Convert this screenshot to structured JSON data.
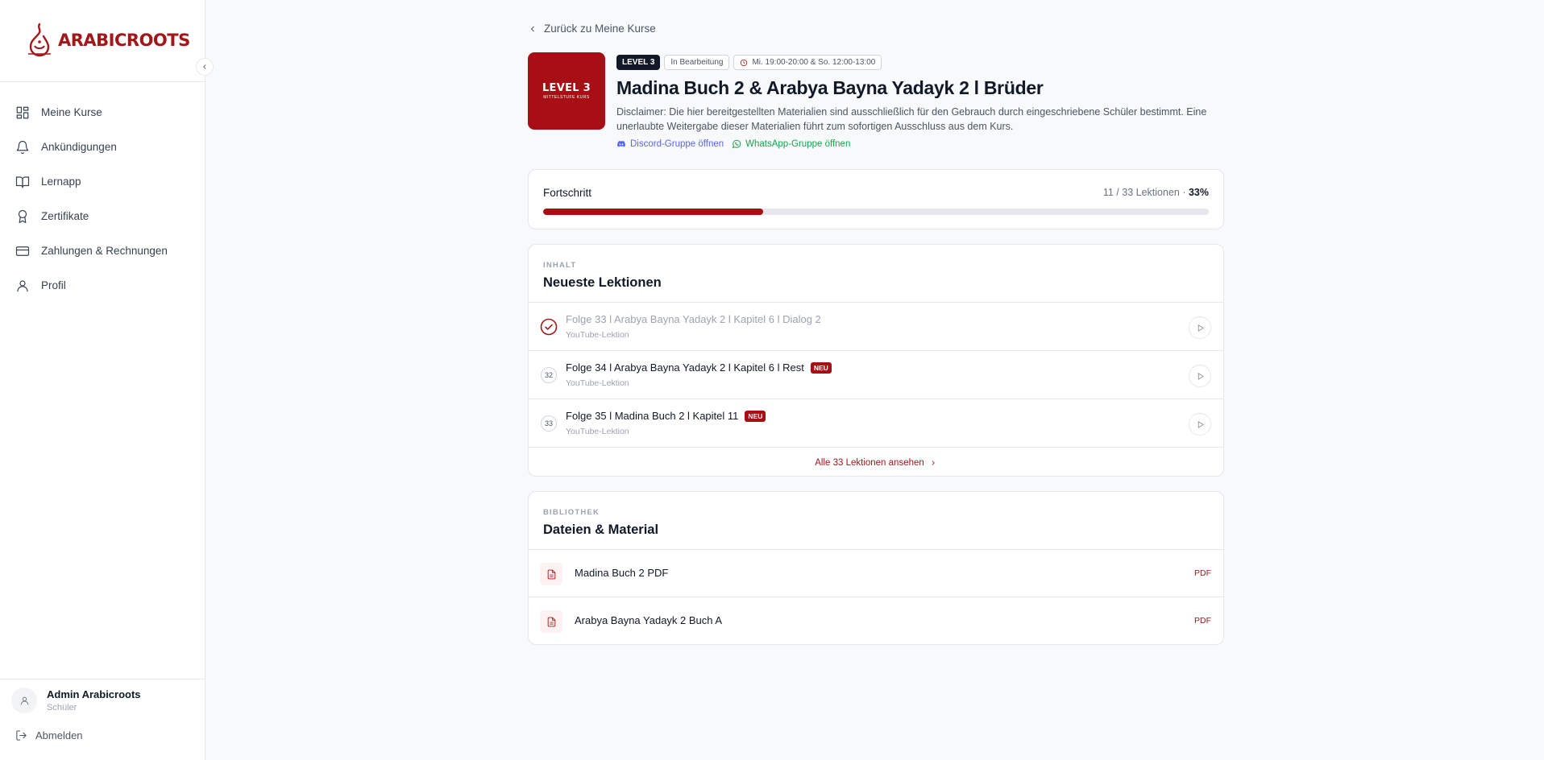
{
  "brand": {
    "name": "ARABICROOTS",
    "accent": "#a80f14"
  },
  "sidebar": {
    "items": [
      {
        "label": "Meine Kurse",
        "icon": "dashboard-icon"
      },
      {
        "label": "Ankündigungen",
        "icon": "bell-icon"
      },
      {
        "label": "Lernapp",
        "icon": "book-icon"
      },
      {
        "label": "Zertifikate",
        "icon": "award-icon"
      },
      {
        "label": "Zahlungen & Rechnungen",
        "icon": "credit-card-icon"
      },
      {
        "label": "Profil",
        "icon": "user-icon"
      }
    ],
    "user": {
      "name": "Admin Arabicroots",
      "role": "Schüler"
    },
    "logout": "Abmelden"
  },
  "course": {
    "back_label": "Zurück zu Meine Kurse",
    "thumb_title": "LEVEL 3",
    "thumb_subtitle": "MITTELSTUFE KURS",
    "level_badge": "LEVEL 3",
    "status_badge": "In Bearbeitung",
    "schedule": "Mi. 19:00-20:00 & So. 12:00-13:00",
    "title": "Madina Buch 2 & Arabya Bayna Yadayk 2 l Brüder",
    "disclaimer": "Disclaimer: Die hier bereitgestellten Materialien sind ausschließlich für den Gebrauch durch eingeschriebene Schüler bestimmt. Eine unerlaubte Weitergabe dieser Materialien führt zum sofortigen Ausschluss aus dem Kurs.",
    "discord_label": "Discord-Gruppe öffnen",
    "whatsapp_label": "WhatsApp-Gruppe öffnen"
  },
  "progress": {
    "label": "Fortschritt",
    "count": "11 / 33 Lektionen ·",
    "percent_label": "33%",
    "percent": 33
  },
  "lessons": {
    "eyebrow": "INHALT",
    "title": "Neueste Lektionen",
    "items": [
      {
        "marker": "",
        "done": true,
        "title": "Folge 33 l Arabya Bayna Yadayk 2 l Kapitel 6 l Dialog 2",
        "badge": "",
        "subtitle": "YouTube-Lektion"
      },
      {
        "marker": "32",
        "done": false,
        "title": "Folge 34 l Arabya Bayna Yadayk 2 l Kapitel 6 l Rest",
        "badge": "NEU",
        "subtitle": "YouTube-Lektion"
      },
      {
        "marker": "33",
        "done": false,
        "title": "Folge 35 l Madina Buch 2 l Kapitel 11",
        "badge": "NEU",
        "subtitle": "YouTube-Lektion"
      }
    ],
    "all_label": "Alle 33 Lektionen ansehen"
  },
  "library": {
    "eyebrow": "BIBLIOTHEK",
    "title": "Dateien & Material",
    "files": [
      {
        "name": "Madina Buch 2 PDF",
        "type": "PDF"
      },
      {
        "name": "Arabya Bayna Yadayk 2 Buch A",
        "type": "PDF"
      }
    ]
  }
}
